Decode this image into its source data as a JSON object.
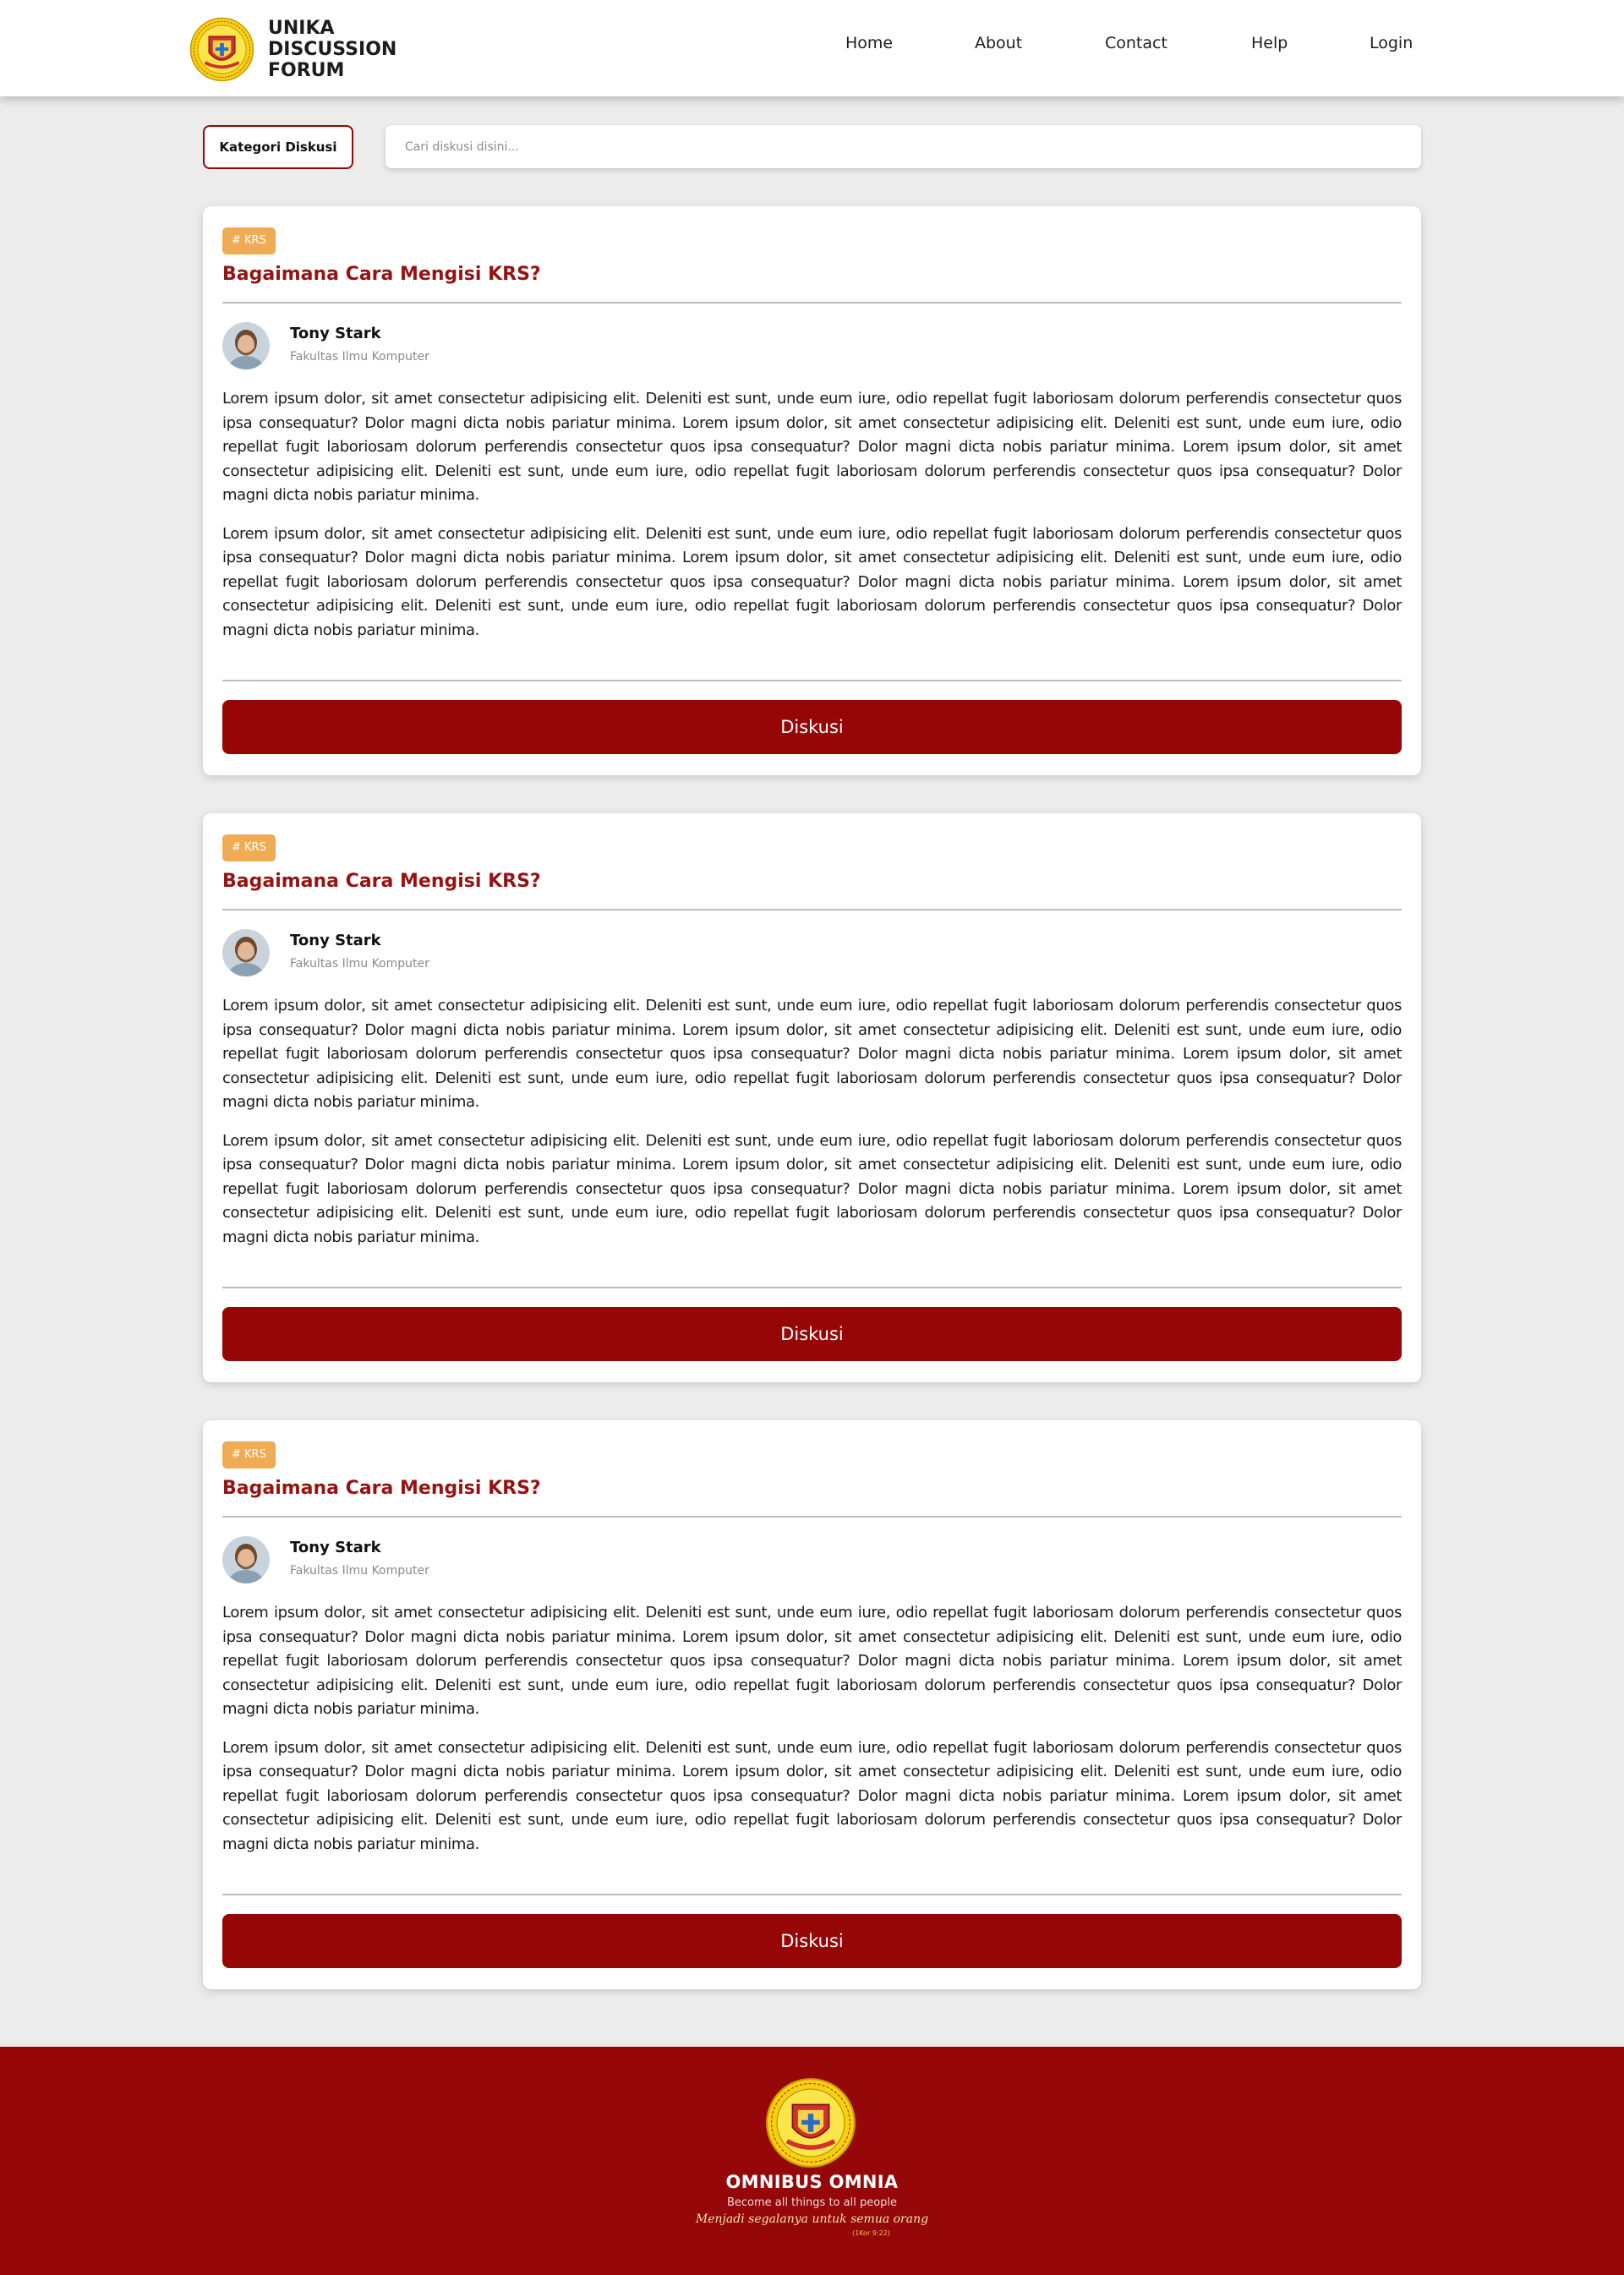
{
  "header": {
    "brand_line1": "UNIKA DISCUSSION",
    "brand_line2": "FORUM",
    "nav": [
      {
        "label": "Home"
      },
      {
        "label": "About"
      },
      {
        "label": "Contact"
      },
      {
        "label": "Help"
      },
      {
        "label": "Login"
      }
    ]
  },
  "search": {
    "category_label": "Kategori Diskusi",
    "placeholder": "Cari diskusi disini..."
  },
  "posts": [
    {
      "tag": "# KRS",
      "title": "Bagaimana Cara Mengisi KRS?",
      "author": "Tony Stark",
      "faculty": "Fakultas Ilmu Komputer",
      "paragraphs": [
        "Lorem ipsum dolor, sit amet consectetur adipisicing elit. Deleniti est sunt, unde eum iure, odio repellat fugit laboriosam dolorum perferendis consectetur quos ipsa consequatur? Dolor magni dicta nobis pariatur minima. Lorem ipsum dolor, sit amet consectetur adipisicing elit. Deleniti est sunt, unde eum iure, odio repellat fugit laboriosam dolorum perferendis consectetur quos ipsa consequatur? Dolor magni dicta nobis pariatur minima. Lorem ipsum dolor, sit amet consectetur adipisicing elit. Deleniti est sunt, unde eum iure, odio repellat fugit laboriosam dolorum perferendis consectetur quos ipsa consequatur? Dolor magni dicta nobis pariatur minima.",
        "Lorem ipsum dolor, sit amet consectetur adipisicing elit. Deleniti est sunt, unde eum iure, odio repellat fugit laboriosam dolorum perferendis consectetur quos ipsa consequatur? Dolor magni dicta nobis pariatur minima. Lorem ipsum dolor, sit amet consectetur adipisicing elit. Deleniti est sunt, unde eum iure, odio repellat fugit laboriosam dolorum perferendis consectetur quos ipsa consequatur? Dolor magni dicta nobis pariatur minima. Lorem ipsum dolor, sit amet consectetur adipisicing elit. Deleniti est sunt, unde eum iure, odio repellat fugit laboriosam dolorum perferendis consectetur quos ipsa consequatur? Dolor magni dicta nobis pariatur minima."
      ],
      "button": "Diskusi"
    },
    {
      "tag": "# KRS",
      "title": "Bagaimana Cara Mengisi KRS?",
      "author": "Tony Stark",
      "faculty": "Fakultas Ilmu Komputer",
      "paragraphs": [
        "Lorem ipsum dolor, sit amet consectetur adipisicing elit. Deleniti est sunt, unde eum iure, odio repellat fugit laboriosam dolorum perferendis consectetur quos ipsa consequatur? Dolor magni dicta nobis pariatur minima. Lorem ipsum dolor, sit amet consectetur adipisicing elit. Deleniti est sunt, unde eum iure, odio repellat fugit laboriosam dolorum perferendis consectetur quos ipsa consequatur? Dolor magni dicta nobis pariatur minima. Lorem ipsum dolor, sit amet consectetur adipisicing elit. Deleniti est sunt, unde eum iure, odio repellat fugit laboriosam dolorum perferendis consectetur quos ipsa consequatur? Dolor magni dicta nobis pariatur minima.",
        "Lorem ipsum dolor, sit amet consectetur adipisicing elit. Deleniti est sunt, unde eum iure, odio repellat fugit laboriosam dolorum perferendis consectetur quos ipsa consequatur? Dolor magni dicta nobis pariatur minima. Lorem ipsum dolor, sit amet consectetur adipisicing elit. Deleniti est sunt, unde eum iure, odio repellat fugit laboriosam dolorum perferendis consectetur quos ipsa consequatur? Dolor magni dicta nobis pariatur minima. Lorem ipsum dolor, sit amet consectetur adipisicing elit. Deleniti est sunt, unde eum iure, odio repellat fugit laboriosam dolorum perferendis consectetur quos ipsa consequatur? Dolor magni dicta nobis pariatur minima."
      ],
      "button": "Diskusi"
    },
    {
      "tag": "# KRS",
      "title": "Bagaimana Cara Mengisi KRS?",
      "author": "Tony Stark",
      "faculty": "Fakultas Ilmu Komputer",
      "paragraphs": [
        "Lorem ipsum dolor, sit amet consectetur adipisicing elit. Deleniti est sunt, unde eum iure, odio repellat fugit laboriosam dolorum perferendis consectetur quos ipsa consequatur? Dolor magni dicta nobis pariatur minima. Lorem ipsum dolor, sit amet consectetur adipisicing elit. Deleniti est sunt, unde eum iure, odio repellat fugit laboriosam dolorum perferendis consectetur quos ipsa consequatur? Dolor magni dicta nobis pariatur minima. Lorem ipsum dolor, sit amet consectetur adipisicing elit. Deleniti est sunt, unde eum iure, odio repellat fugit laboriosam dolorum perferendis consectetur quos ipsa consequatur? Dolor magni dicta nobis pariatur minima.",
        "Lorem ipsum dolor, sit amet consectetur adipisicing elit. Deleniti est sunt, unde eum iure, odio repellat fugit laboriosam dolorum perferendis consectetur quos ipsa consequatur? Dolor magni dicta nobis pariatur minima. Lorem ipsum dolor, sit amet consectetur adipisicing elit. Deleniti est sunt, unde eum iure, odio repellat fugit laboriosam dolorum perferendis consectetur quos ipsa consequatur? Dolor magni dicta nobis pariatur minima. Lorem ipsum dolor, sit amet consectetur adipisicing elit. Deleniti est sunt, unde eum iure, odio repellat fugit laboriosam dolorum perferendis consectetur quos ipsa consequatur? Dolor magni dicta nobis pariatur minima."
      ],
      "button": "Diskusi"
    }
  ],
  "footer": {
    "motto": "OMNIBUS OMNIA",
    "motto_en": "Become all things to all people",
    "motto_id": "Menjadi segalanya untuk semua orang",
    "motto_ref": "(1Kor 9:22)"
  },
  "colors": {
    "primary": "#960607",
    "tag": "#f0ac54",
    "title": "#951313",
    "background": "#ececec"
  },
  "icons": {
    "logo": "unika-seal-logo",
    "avatar": "user-avatar-photo"
  }
}
